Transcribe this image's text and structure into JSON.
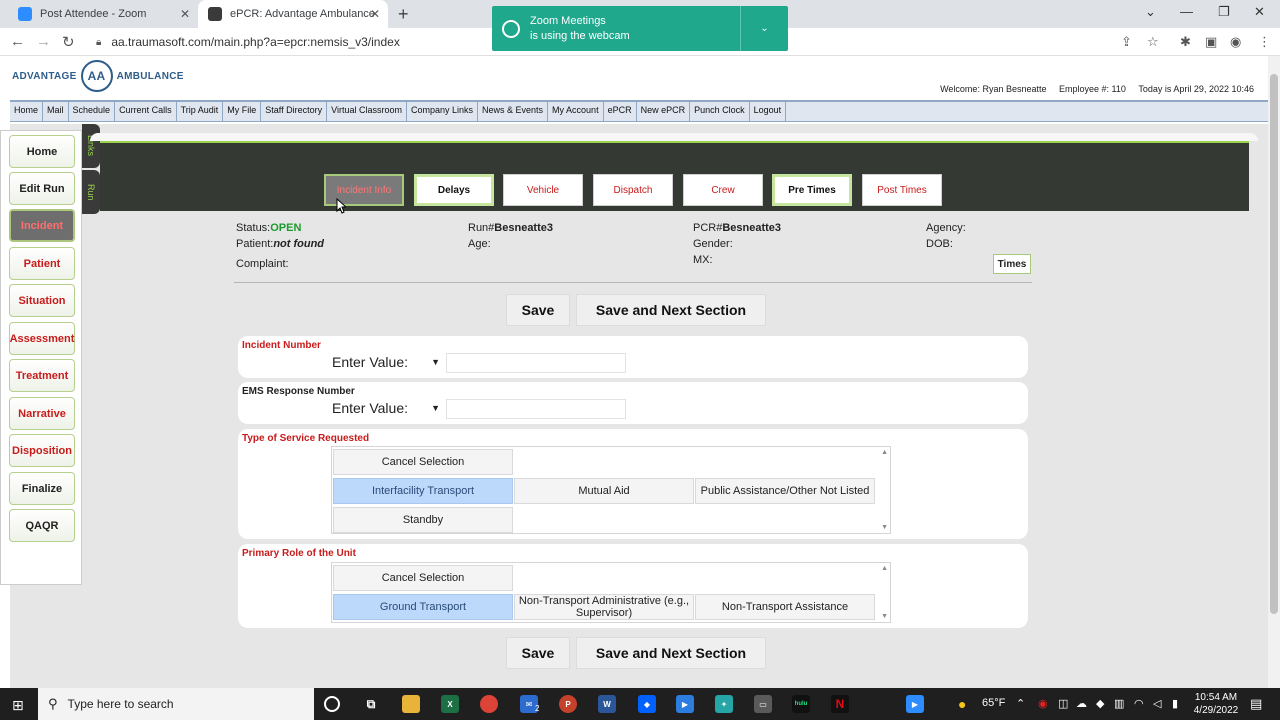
{
  "browser": {
    "tabs": [
      {
        "label": "Post Attendee - Zoom",
        "active": false
      },
      {
        "label": "ePCR: Advantage Ambulance",
        "active": true
      }
    ],
    "url": "aa.traumasoft.com/main.php?a=epcr:nemsis_v3/index"
  },
  "zoom_popup": {
    "line1": "Zoom Meetings",
    "line2": "is using the webcam"
  },
  "header": {
    "logo_left": "ADVANTAGE",
    "logo_mark": "AA",
    "logo_right": "AMBULANCE",
    "welcome": "Welcome: Ryan Besneatte",
    "employee": "Employee #: 110",
    "today": "Today is April 29, 2022 10:46"
  },
  "menu": [
    "Home",
    "Mail",
    "Schedule",
    "Current Calls",
    "Trip Audit",
    "My File",
    "Staff Directory",
    "Virtual Classroom",
    "Company Links",
    "News & Events",
    "My Account",
    "ePCR",
    "New ePCR",
    "Punch Clock",
    "Logout"
  ],
  "leftnav": [
    "Home",
    "Edit Run",
    "Incident",
    "Patient",
    "Situation",
    "Assessment",
    "Treatment",
    "Narrative",
    "Disposition",
    "Finalize",
    "QAQR"
  ],
  "sidetabs": [
    "Links",
    "Run"
  ],
  "section_tabs": [
    "Incident Info",
    "Delays",
    "Vehicle",
    "Dispatch",
    "Crew",
    "Pre Times",
    "Post Times"
  ],
  "info": {
    "status_label": "Status:",
    "status_value": "OPEN",
    "patient_label": "Patient:",
    "patient_value": "not found",
    "complaint_label": "Complaint:",
    "run_label": "Run#",
    "run_value": "Besneatte3",
    "age_label": "Age:",
    "pcr_label": "PCR#",
    "pcr_value": "Besneatte3",
    "gender_label": "Gender:",
    "mx_label": "MX:",
    "agency_label": "Agency:",
    "dob_label": "DOB:",
    "times_button": "Times"
  },
  "actions": {
    "save": "Save",
    "save_next": "Save and Next Section"
  },
  "fields": {
    "incident_number": {
      "label": "Incident Number",
      "select": "Enter Value:",
      "value": ""
    },
    "ems_response": {
      "label": "EMS Response Number",
      "select": "Enter Value:",
      "value": ""
    },
    "type_of_service": {
      "label": "Type of Service Requested",
      "options": [
        "Cancel Selection",
        "Interfacility Transport",
        "Mutual Aid",
        "Public Assistance/Other Not Listed",
        "Standby"
      ],
      "selected": "Interfacility Transport"
    },
    "primary_role": {
      "label": "Primary Role of the Unit",
      "options": [
        "Cancel Selection",
        "Ground Transport",
        "Non-Transport Administrative (e.g., Supervisor)",
        "Non-Transport Assistance"
      ],
      "selected": "Ground Transport"
    }
  },
  "taskbar": {
    "search_placeholder": "Type here to search",
    "weather": "65°F",
    "time": "10:54 AM",
    "date": "4/29/2022",
    "mail_badge": "2"
  }
}
